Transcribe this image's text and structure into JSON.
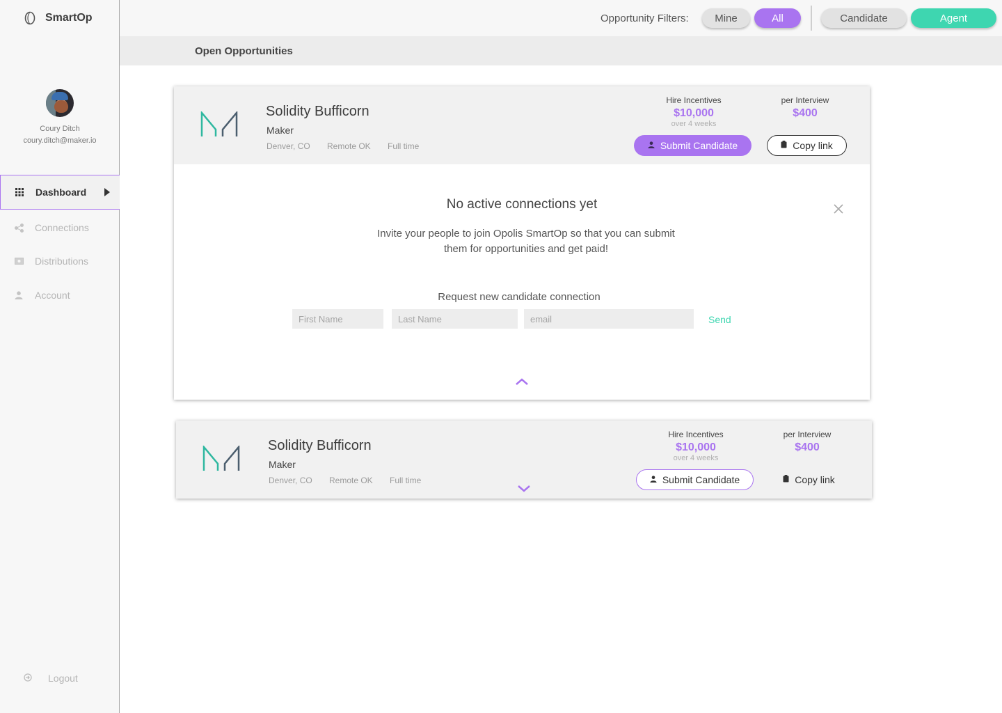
{
  "app": {
    "name": "SmartOp"
  },
  "user": {
    "name": "Coury Ditch",
    "email": "coury.ditch@maker.io"
  },
  "nav": {
    "items": [
      {
        "label": "Dashboard",
        "icon": "grid-icon",
        "active": true
      },
      {
        "label": "Connections",
        "icon": "share-icon",
        "active": false
      },
      {
        "label": "Distributions",
        "icon": "money-icon",
        "active": false
      },
      {
        "label": "Account",
        "icon": "person-icon",
        "active": false
      }
    ],
    "logout_label": "Logout"
  },
  "topbar": {
    "filters_label": "Opportunity Filters:",
    "filter_mine": "Mine",
    "filter_all": "All",
    "role_candidate": "Candidate",
    "role_agent": "Agent"
  },
  "section": {
    "title": "Open Opportunities"
  },
  "opportunities": [
    {
      "title": "Solidity Bufficorn",
      "company": "Maker",
      "location": "Denver, CO",
      "remote": "Remote OK",
      "type": "Full time",
      "hire_label": "Hire Incentives",
      "hire_value": "$10,000",
      "hire_sub": "over 4 weeks",
      "interview_label": "per Interview",
      "interview_value": "$400",
      "submit_label": "Submit Candidate",
      "copy_label": "Copy link",
      "expanded": true
    },
    {
      "title": "Solidity Bufficorn",
      "company": "Maker",
      "location": "Denver, CO",
      "remote": "Remote OK",
      "type": "Full time",
      "hire_label": "Hire Incentives",
      "hire_value": "$10,000",
      "hire_sub": "over 4 weeks",
      "interview_label": "per Interview",
      "interview_value": "$400",
      "submit_label": "Submit Candidate",
      "copy_label": "Copy link",
      "expanded": false
    }
  ],
  "connections_panel": {
    "title": "No active connections yet",
    "description": "Invite your people to join Opolis SmartOp so that you can submit them for opportunities and get paid!",
    "request_title": "Request new candidate connection",
    "first_name_placeholder": "First Name",
    "last_name_placeholder": "Last Name",
    "email_placeholder": "email",
    "send_label": "Send"
  },
  "colors": {
    "accent": "#a974f0",
    "agent": "#3ed6b0",
    "logo_teal": "#2fb8a0",
    "logo_slate": "#4b5e6e"
  }
}
